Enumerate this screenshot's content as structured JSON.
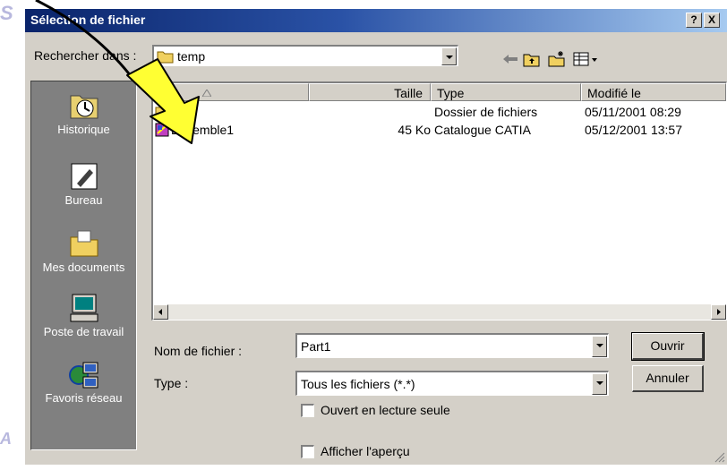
{
  "dialog": {
    "title": "Sélection de fichier",
    "help_btn": "?",
    "close_btn": "X"
  },
  "look_in": {
    "label": "Rechercher dans :",
    "value": "temp"
  },
  "places": [
    {
      "label": "Historique",
      "icon": "history-icon"
    },
    {
      "label": "Bureau",
      "icon": "desktop-icon"
    },
    {
      "label": "Mes documents",
      "icon": "my-documents-icon"
    },
    {
      "label": "Poste de travail",
      "icon": "my-computer-icon"
    },
    {
      "label": "Favoris réseau",
      "icon": "network-places-icon"
    }
  ],
  "list": {
    "columns": [
      "",
      "Taille",
      "Type",
      "Modifié le"
    ],
    "rows": [
      {
        "name": "",
        "size": "",
        "type": "Dossier de fichiers",
        "modified": "05/11/2001 08:29",
        "icon": "folder-icon"
      },
      {
        "name": "Ensemble1",
        "size": "45 Ko",
        "type": "Catalogue CATIA",
        "modified": "05/12/2001 13:57",
        "icon": "catia-catalog-icon"
      }
    ]
  },
  "filename": {
    "label": "Nom de fichier :",
    "value": "Part1"
  },
  "filetype": {
    "label": "Type :",
    "value": "Tous les fichiers (*.*)"
  },
  "buttons": {
    "open": "Ouvrir",
    "cancel": "Annuler"
  },
  "checkboxes": {
    "readonly": "Ouvert en lecture seule",
    "preview": "Afficher l'aperçu"
  },
  "colors": {
    "title_start": "#0a246a",
    "title_end": "#a6caf0",
    "face": "#d4d0c8",
    "places_bg": "#808080",
    "arrow_fill": "#ffff33"
  }
}
